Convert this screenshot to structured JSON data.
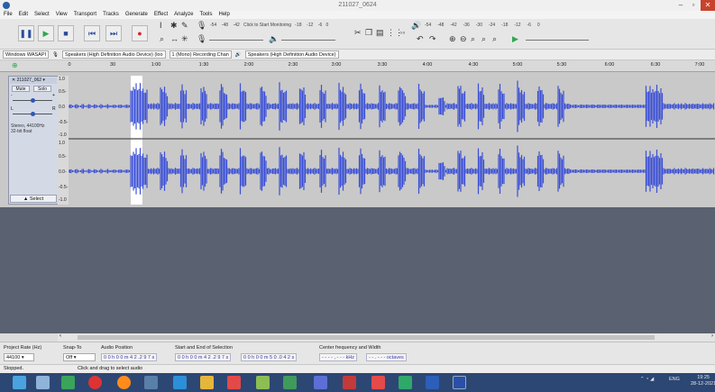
{
  "window": {
    "title": "211027_0624"
  },
  "menu": [
    "File",
    "Edit",
    "Select",
    "View",
    "Transport",
    "Tracks",
    "Generate",
    "Effect",
    "Analyze",
    "Tools",
    "Help"
  ],
  "transport": {
    "pause_icon": "pause-icon",
    "play_icon": "play-icon",
    "stop_icon": "stop-icon",
    "skip_start_icon": "skip-start-icon",
    "skip_end_icon": "skip-end-icon",
    "record_icon": "record-icon",
    "play_color": "#2fa84f",
    "record_color": "#d9262b"
  },
  "meters": {
    "record_ticks": [
      "-54",
      "-48",
      "-42",
      "-18",
      "-12",
      "-6",
      "0"
    ],
    "click_monitor": "Click to Start Monitoring",
    "play_ticks": [
      "-54",
      "-48",
      "-42",
      "-36",
      "-30",
      "-24",
      "-18",
      "-12",
      "-6",
      "0"
    ]
  },
  "devices": {
    "host": "Windows WASAPI",
    "recording_device": "Speakers (High Definition Audio Device) (loo",
    "channels": "1 (Mono) Recording Chan",
    "playback_device": "Speakers (High Definition Audio Device)"
  },
  "timeline": {
    "ticks": [
      "0",
      "30",
      "1:00",
      "1:30",
      "2:00",
      "2:30",
      "3:00",
      "3:30",
      "4:00",
      "4:30",
      "5:00",
      "5:30",
      "6:00",
      "6:30",
      "7:00"
    ]
  },
  "track": {
    "name": "211027_062",
    "mute": "Mute",
    "solo": "Solo",
    "gain_minus": "-",
    "gain_plus": "+",
    "pan_left": "L",
    "pan_right": "R",
    "format_line1": "Stereo, 44100Hz",
    "format_line2": "32-bit float",
    "select_label": "Select",
    "scale_labels": [
      "1.0",
      "0.5-",
      "0.0",
      "-0.5-",
      "-1.0",
      "1.0",
      "0.5-",
      "0.0-",
      "-0.5-",
      "-1.0"
    ]
  },
  "selection_toolbar": {
    "project_rate_label": "Project Rate (Hz)",
    "project_rate_value": "44100",
    "snap_to_label": "Snap-To",
    "snap_to_value": "Off",
    "audio_position_label": "Audio Position",
    "audio_position_value": "0 0 h 0 0 m 4 2 .2 9 7 s",
    "selection_label": "Start and End of Selection",
    "selection_start": "0 0 h 0 0 m 4 2 .2 9 7 s",
    "selection_end": "0 0 h 0 0 m 5 0 .0 4 2 s",
    "center_label": "Center frequency and Width",
    "center_value": "- - - - , - - - kHz",
    "width_value": "- - . - - - octaves"
  },
  "status": {
    "state": "Stopped.",
    "hint": "Click and drag to select audio"
  },
  "taskbar": {
    "lang": "ENG",
    "time": "19:25",
    "date": "28-12-2021"
  },
  "colors": {
    "waveform": "#3b4fd6",
    "track_bg": "#c9c9c9",
    "selection": "#ffffff",
    "empty_area": "#5a6171"
  }
}
